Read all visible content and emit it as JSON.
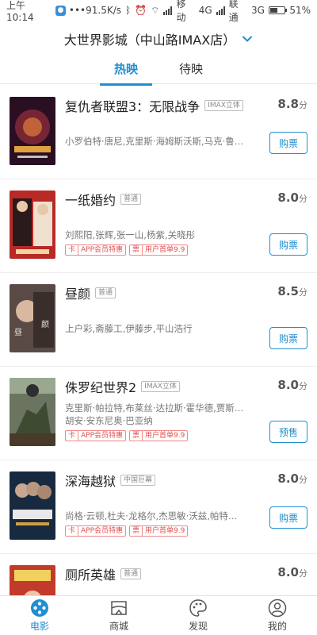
{
  "status_bar": {
    "time": "上午10:14",
    "speed": "91.5K/s",
    "carrier1": "移动",
    "net1": "4G",
    "carrier2": "联通",
    "net2": "3G",
    "battery": "51%",
    "battery_level": 0.51
  },
  "header": {
    "cinema_name": "大世界影城（中山路IMAX店）"
  },
  "tabs": [
    {
      "label": "热映",
      "active": true
    },
    {
      "label": "待映",
      "active": false
    }
  ],
  "movies": [
    {
      "title": "复仇者联盟3：无限战争",
      "tag": "IMAX立体",
      "score": "8.8",
      "score_unit": "分",
      "cast": "小罗伯特·唐尼,克里斯·海姆斯沃斯,马克·鲁法...",
      "promos": [],
      "button": "购票"
    },
    {
      "title": "一纸婚约",
      "tag": "普通",
      "score": "8.0",
      "score_unit": "分",
      "cast": "刘熙阳,张辉,张一山,杨紫,关晓彤",
      "promos": [
        {
          "k": "卡",
          "v": "APP会员特惠"
        },
        {
          "k": "票",
          "v": "用户首单9.9"
        }
      ],
      "button": "购票"
    },
    {
      "title": "昼颜",
      "tag": "普通",
      "score": "8.5",
      "score_unit": "分",
      "cast": "上户彩,斋藤工,伊藤步,平山浩行",
      "promos": [],
      "button": "购票"
    },
    {
      "title": "侏罗纪世界2",
      "tag": "IMAX立体",
      "score": "8.0",
      "score_unit": "分",
      "cast": "克里斯·帕拉特,布莱丝·达拉斯·霍华德,贾斯提...",
      "cast2": "胡安·安东尼奥·巴亚纳",
      "promos": [
        {
          "k": "卡",
          "v": "APP会员特惠"
        },
        {
          "k": "票",
          "v": "用户首单9.9"
        }
      ],
      "button": "预售"
    },
    {
      "title": "深海越狱",
      "tag": "中国巨幕",
      "score": "8.0",
      "score_unit": "分",
      "cast": "尚格·云顿,杜夫·龙格尔,杰思敏·沃兹,帕特里克...",
      "promos": [
        {
          "k": "卡",
          "v": "APP会员特惠"
        },
        {
          "k": "票",
          "v": "用户首单9.9"
        }
      ],
      "button": "购票"
    },
    {
      "title": "厕所英雄",
      "tag": "普通",
      "score": "8.0",
      "score_unit": "分",
      "cast": "",
      "promos": [],
      "button": ""
    }
  ],
  "poster_colors": [
    "#3b1a2e",
    "#c9302c",
    "#6a5a55",
    "#5f6a48",
    "#1d3552",
    "#c23b2a"
  ],
  "bottom_nav": [
    {
      "label": "电影",
      "icon": "film-reel-icon",
      "active": true
    },
    {
      "label": "商城",
      "icon": "store-icon",
      "active": false
    },
    {
      "label": "发现",
      "icon": "discover-icon",
      "active": false
    },
    {
      "label": "我的",
      "icon": "profile-icon",
      "active": false
    }
  ],
  "accent_color": "#1f8fcf"
}
